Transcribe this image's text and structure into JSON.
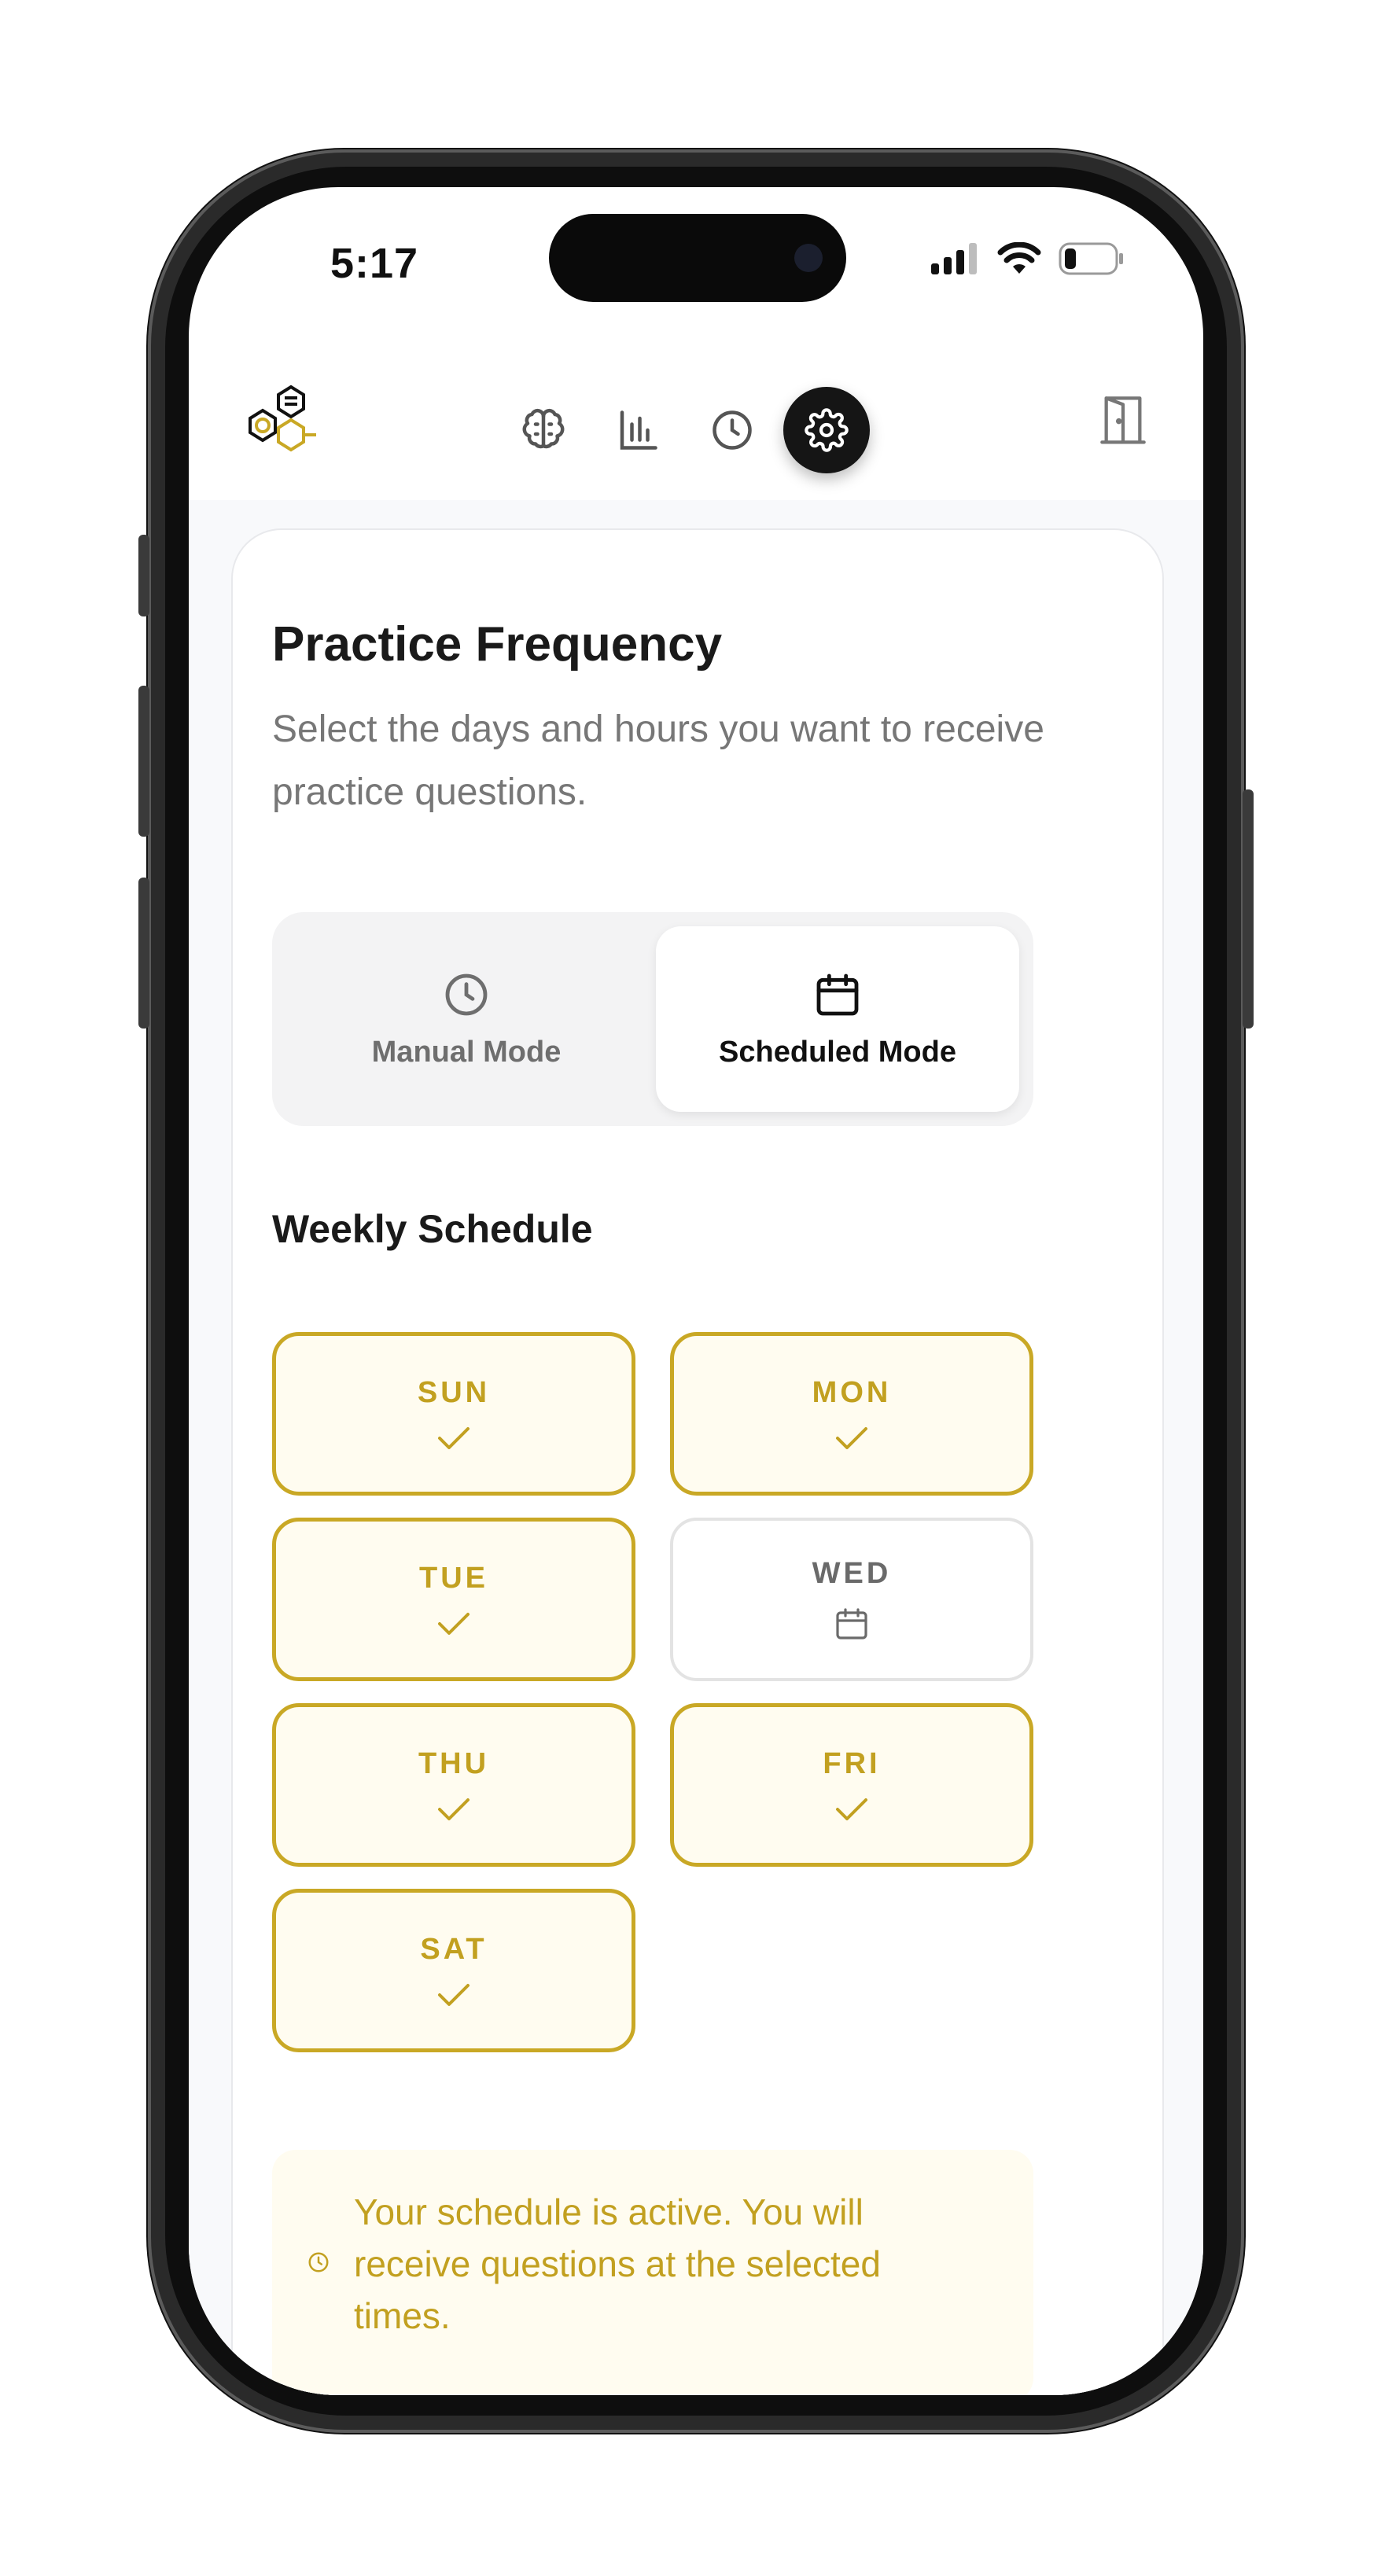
{
  "status_bar": {
    "time": "5:17"
  },
  "nav": {
    "items": [
      {
        "name": "brain",
        "active": false
      },
      {
        "name": "stats",
        "active": false
      },
      {
        "name": "history",
        "active": false
      },
      {
        "name": "settings",
        "active": true
      }
    ]
  },
  "page": {
    "title": "Practice Frequency",
    "subtitle": "Select the days and hours you want to receive practice questions."
  },
  "modes": {
    "manual_label": "Manual Mode",
    "scheduled_label": "Scheduled Mode",
    "selected": "Scheduled Mode"
  },
  "schedule": {
    "title": "Weekly Schedule",
    "days": [
      {
        "label": "SUN",
        "selected": true
      },
      {
        "label": "MON",
        "selected": true
      },
      {
        "label": "TUE",
        "selected": true
      },
      {
        "label": "WED",
        "selected": false
      },
      {
        "label": "THU",
        "selected": true
      },
      {
        "label": "FRI",
        "selected": true
      },
      {
        "label": "SAT",
        "selected": true
      }
    ]
  },
  "notice": {
    "text": "Your schedule is active. You will receive questions at the selected times."
  },
  "colors": {
    "accent": "#c9a825",
    "accent_bg": "#fffcf0",
    "dark": "#151515"
  }
}
